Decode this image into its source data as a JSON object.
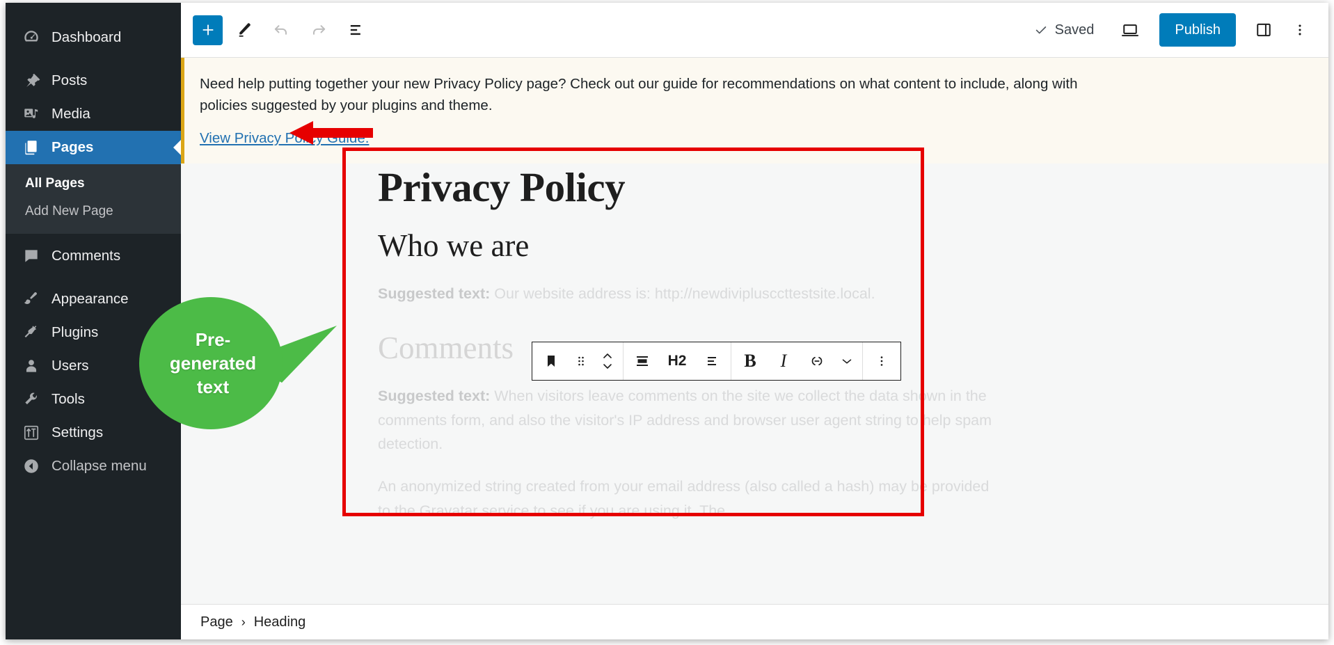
{
  "sidebar": {
    "items": [
      {
        "label": "Dashboard",
        "icon": "dashboard-icon"
      },
      {
        "label": "Posts",
        "icon": "pin-icon"
      },
      {
        "label": "Media",
        "icon": "media-icon"
      },
      {
        "label": "Pages",
        "icon": "pages-icon",
        "current": true
      },
      {
        "label": "Comments",
        "icon": "comments-icon"
      },
      {
        "label": "Appearance",
        "icon": "brush-icon"
      },
      {
        "label": "Plugins",
        "icon": "plug-icon"
      },
      {
        "label": "Users",
        "icon": "user-icon"
      },
      {
        "label": "Tools",
        "icon": "wrench-icon"
      },
      {
        "label": "Settings",
        "icon": "settings-icon"
      },
      {
        "label": "Collapse menu",
        "icon": "collapse-icon"
      }
    ],
    "submenu": [
      {
        "label": "All Pages",
        "active": true
      },
      {
        "label": "Add New Page",
        "active": false
      }
    ]
  },
  "toolbar": {
    "add_block_label": "+",
    "tools_icon": "pencil-icon",
    "undo_icon": "undo-icon",
    "redo_icon": "redo-icon",
    "list_view_icon": "list-view-icon",
    "saved_label": "Saved",
    "saved_icon": "check-icon",
    "preview_icon": "desktop-preview-icon",
    "publish_label": "Publish",
    "settings_sidebar_icon": "sidebar-panel-icon",
    "options_icon": "vertical-dots-icon"
  },
  "notice": {
    "text": "Need help putting together your new Privacy Policy page? Check out our guide for recommendations on what content to include, along with policies suggested by your plugins and theme.",
    "link_label": "View Privacy Policy Guide."
  },
  "block_toolbar": {
    "block_type_icon": "paragraph-block-icon",
    "drag_icon": "drag-handle-icon",
    "move_icon": "move-up-down-icon",
    "align_icon": "align-block-icon",
    "heading_level_label": "H2",
    "text_align_icon": "text-align-icon",
    "bold_label": "B",
    "italic_label": "I",
    "link_icon": "link-icon",
    "more_rich_text_icon": "chevron-down-icon",
    "options_icon": "vertical-dots-icon"
  },
  "document": {
    "post_title": "Privacy Policy",
    "heading_who_we_are": "Who we are",
    "paragraph_address_prefix": "Suggested text:",
    "paragraph_address_body": " Our website address is: http://newdiviplusccttestsite.local.",
    "heading_comments": "Comments",
    "paragraph_comments_prefix": "Suggested text:",
    "paragraph_comments_body": " When visitors leave comments on the site we collect the data shown in the comments form, and also the visitor's IP address and browser user agent string to help spam detection.",
    "paragraph_gravatar": "An anonymized string created from your email address (also called a hash) may be provided to the Gravatar service to see if you are using it. The"
  },
  "footer": {
    "breadcrumb": [
      {
        "label": "Page"
      },
      {
        "label": "Heading"
      }
    ],
    "separator": "›"
  },
  "annotations": {
    "callout_text_line1": "Pre-",
    "callout_text_line2": "generated",
    "callout_text_line3": "text",
    "callout_color": "#4cbb47",
    "highlight_color": "#e60000",
    "arrow_color": "#e60000"
  }
}
